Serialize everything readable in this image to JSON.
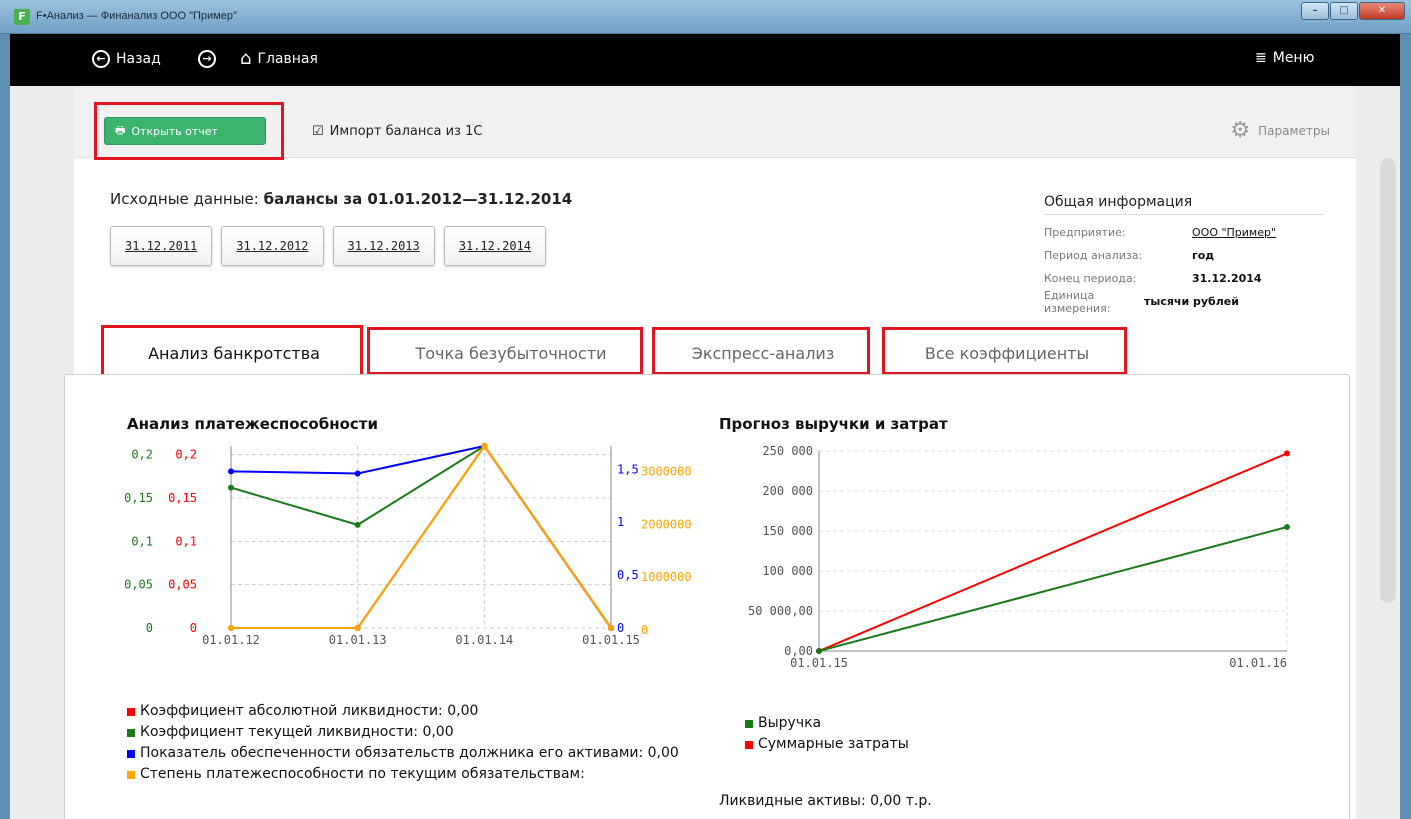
{
  "window": {
    "title": "F•Анализ — Финанализ ООО \"Пример\"",
    "logo": "F"
  },
  "nav": {
    "back": "Назад",
    "home": "Главная",
    "menu": "Меню"
  },
  "toolbar": {
    "open_report": "Открыть отчет",
    "import": "Импорт баланса из 1С",
    "params": "Параметры"
  },
  "source": {
    "label": "Исходные данные:",
    "value": "балансы за 01.01.2012—31.12.2014",
    "dates": [
      "31.12.2011",
      "31.12.2012",
      "31.12.2013",
      "31.12.2014"
    ]
  },
  "info": {
    "title": "Общая информация",
    "rows": [
      {
        "k": "Предприятие:",
        "v": "ООО \"Пример\""
      },
      {
        "k": "Период анализа:",
        "v": "год"
      },
      {
        "k": "Конец периода:",
        "v": "31.12.2014"
      },
      {
        "k": "Единица измерения:",
        "v": "тысячи рублей"
      }
    ]
  },
  "tabs": [
    "Анализ банкротства",
    "Точка безубыточности",
    "Экспресс-анализ",
    "Все коэффициенты"
  ],
  "legend_left": [
    {
      "label": "Коэффициент абсолютной ликвидности: 0,00",
      "color": "#ff0000"
    },
    {
      "label": "Коэффициент текущей ликвидности: 0,00",
      "color": "#1a7a1a"
    },
    {
      "label": "Показатель обеспеченности обязательств должника его активами: 0,00",
      "color": "#0000ff"
    },
    {
      "label": "Степень платежеспособности по текущим обязательствам:",
      "color": "#ffa500"
    }
  ],
  "legend_right": [
    {
      "label": "Выручка",
      "color": "#1a7a1a"
    },
    {
      "label": "Суммарные затраты",
      "color": "#ff0000"
    }
  ],
  "liquid_assets": "Ликвидные активы: 0,00 т.р.",
  "chart_data": [
    {
      "type": "line",
      "title": "Анализ платежеспособности",
      "categories": [
        "01.01.12",
        "01.01.13",
        "01.01.14",
        "01.01.15"
      ],
      "axes": {
        "left_green": {
          "ticks": [
            "0",
            "0,05",
            "0,1",
            "0,15",
            "0,2"
          ],
          "color": "#1a7a1a"
        },
        "left_red": {
          "ticks": [
            "0",
            "0,05",
            "0,1",
            "0,15",
            "0,2"
          ],
          "color": "#ff0000"
        },
        "right_blue": {
          "ticks": [
            "0",
            "0,5",
            "1",
            "1,5"
          ],
          "color": "#0000ff"
        },
        "right_orange": {
          "ticks": [
            "0",
            "1000000",
            "2000000",
            "3000000"
          ],
          "color": "#ffa500"
        }
      },
      "series": [
        {
          "color": "#0000ff",
          "axis": "right_blue",
          "range": [
            0,
            1.5
          ],
          "values": [
            1.48,
            1.46,
            1.72,
            0
          ]
        },
        {
          "color": "#1a7a1a",
          "axis": "left_green",
          "range": [
            0,
            0.2
          ],
          "values": [
            0.162,
            0.119,
            0.21,
            0
          ]
        },
        {
          "color": "#ff0000",
          "axis": "left_red",
          "range": [
            0,
            0.2
          ],
          "values": [
            0,
            0,
            0.21,
            0
          ]
        },
        {
          "color": "#ffa500",
          "axis": "right_orange",
          "range": [
            0,
            3000000
          ],
          "values": [
            0,
            0,
            3450000,
            0
          ]
        }
      ],
      "grid": true
    },
    {
      "type": "line",
      "title": "Прогноз выручки и затрат",
      "categories": [
        "01.01.15",
        "01.01.16"
      ],
      "yticks": [
        "0,00",
        "50 000,00",
        "100 000",
        "150 000",
        "200 000",
        "250 000"
      ],
      "ylim": [
        0,
        250000
      ],
      "series": [
        {
          "color": "#ff0000",
          "values": [
            0,
            247000
          ]
        },
        {
          "color": "#1a7a1a",
          "values": [
            0,
            155000
          ]
        }
      ],
      "grid": true
    }
  ]
}
